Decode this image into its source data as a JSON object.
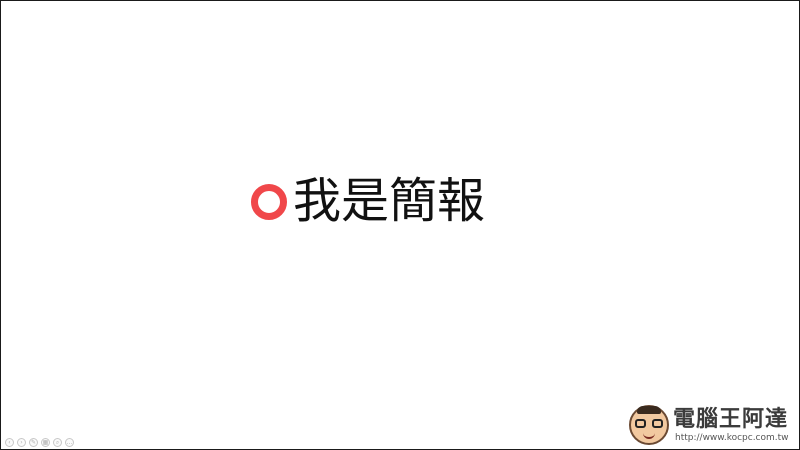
{
  "slide": {
    "title": "我是簡報",
    "accent_color": "#f0474a",
    "text_color": "#111111",
    "background": "#ffffff"
  },
  "controls": {
    "items": [
      {
        "icon": "previous-icon",
        "glyph": "‹"
      },
      {
        "icon": "next-icon",
        "glyph": "›"
      },
      {
        "icon": "pen-icon",
        "glyph": "✎"
      },
      {
        "icon": "slides-overview-icon",
        "glyph": "▦"
      },
      {
        "icon": "zoom-icon",
        "glyph": "⌕"
      },
      {
        "icon": "more-icon",
        "glyph": "…"
      }
    ]
  },
  "watermark": {
    "name": "電腦王阿達",
    "url": "http://www.kocpc.com.tw",
    "icon": "mascot-logo-icon"
  }
}
